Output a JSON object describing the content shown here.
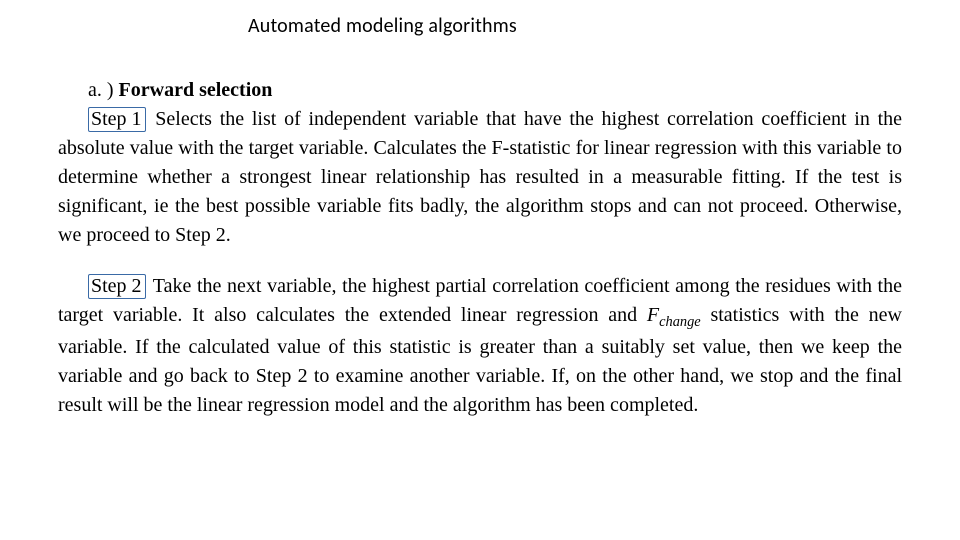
{
  "title": "Automated modeling algorithms",
  "section": {
    "enum": "a. )",
    "heading": "Forward selection"
  },
  "step1": {
    "label": "Step 1",
    "text_after": " Selects the list of independent variable that have the highest correlation coefficient in the absolute value with the target variable. Calculates the F-statistic for linear regression with this variable to determine whether a strongest linear relationship has resulted in a measurable fitting. If the test is significant, ie the best possible variable fits badly, the algorithm stops and can not proceed. Otherwise, we proceed to Step 2."
  },
  "step2": {
    "label": "Step 2",
    "text_before_F": " Take the next variable, the highest partial correlation coefficient among the residues with the target variable. It also calculates the extended linear regression and ",
    "F_symbol": "F",
    "F_subscript": "change",
    "text_after_F": " statistics with the new variable. If the calculated value of this statistic is greater than a suitably set value, then we keep the variable and go back to Step 2 to examine another variable. If, on the other hand, we stop and the final result will be the linear regression model and the algorithm has been completed."
  }
}
